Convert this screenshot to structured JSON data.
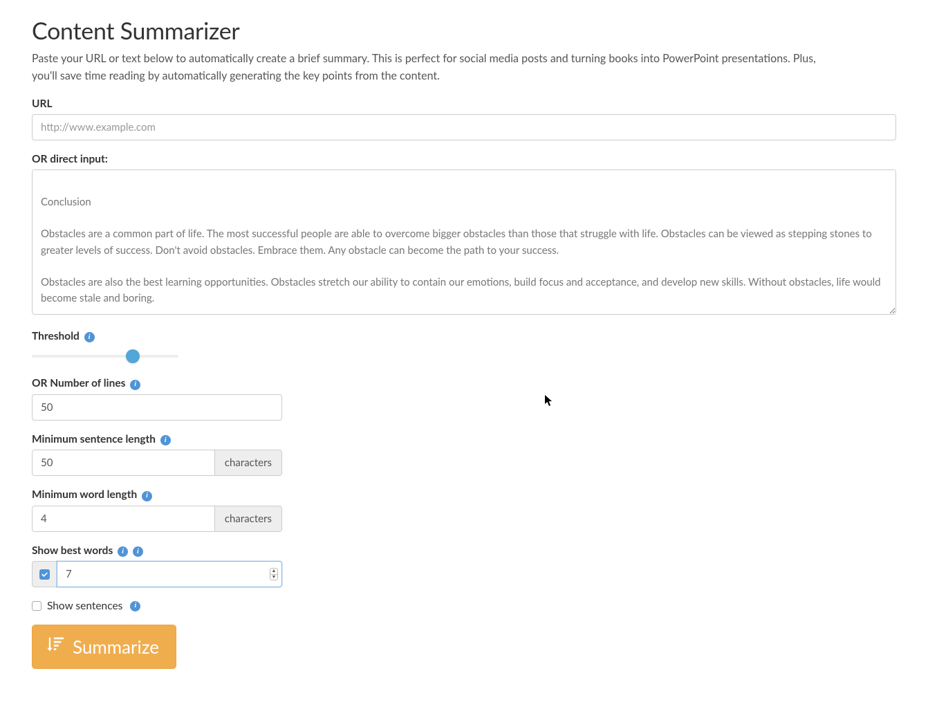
{
  "header": {
    "title": "Content Summarizer",
    "subtitle": "Paste your URL or text below to automatically create a brief summary. This is perfect for social media posts and turning books into PowerPoint presentations. Plus, you'll save time reading by automatically generating the key points from the content."
  },
  "url_field": {
    "label": "URL",
    "placeholder": "http://www.example.com",
    "value": ""
  },
  "direct_input": {
    "label": "OR direct input:",
    "value": "\nConclusion\n\nObstacles are a common part of life. The most successful people are able to overcome bigger obstacles than those that struggle with life. Obstacles can be viewed as stepping stones to greater levels of success. Don't avoid obstacles. Embrace them. Any obstacle can become the path to your success.\n\nObstacles are also the best learning opportunities. Obstacles stretch our ability to contain our emotions, build focus and acceptance, and develop new skills. Without obstacles, life would become stale and boring."
  },
  "threshold": {
    "label": "Threshold",
    "percent": 69
  },
  "num_lines": {
    "label": "OR Number of lines",
    "value": "50"
  },
  "min_sentence": {
    "label": "Minimum sentence length",
    "value": "50",
    "unit": "characters"
  },
  "min_word": {
    "label": "Minimum word length",
    "value": "4",
    "unit": "characters"
  },
  "best_words": {
    "label": "Show best words",
    "checked": true,
    "value": "7"
  },
  "show_sentences": {
    "label": "Show sentences",
    "checked": false
  },
  "submit_label": "Summarize",
  "info_glyph": "i"
}
